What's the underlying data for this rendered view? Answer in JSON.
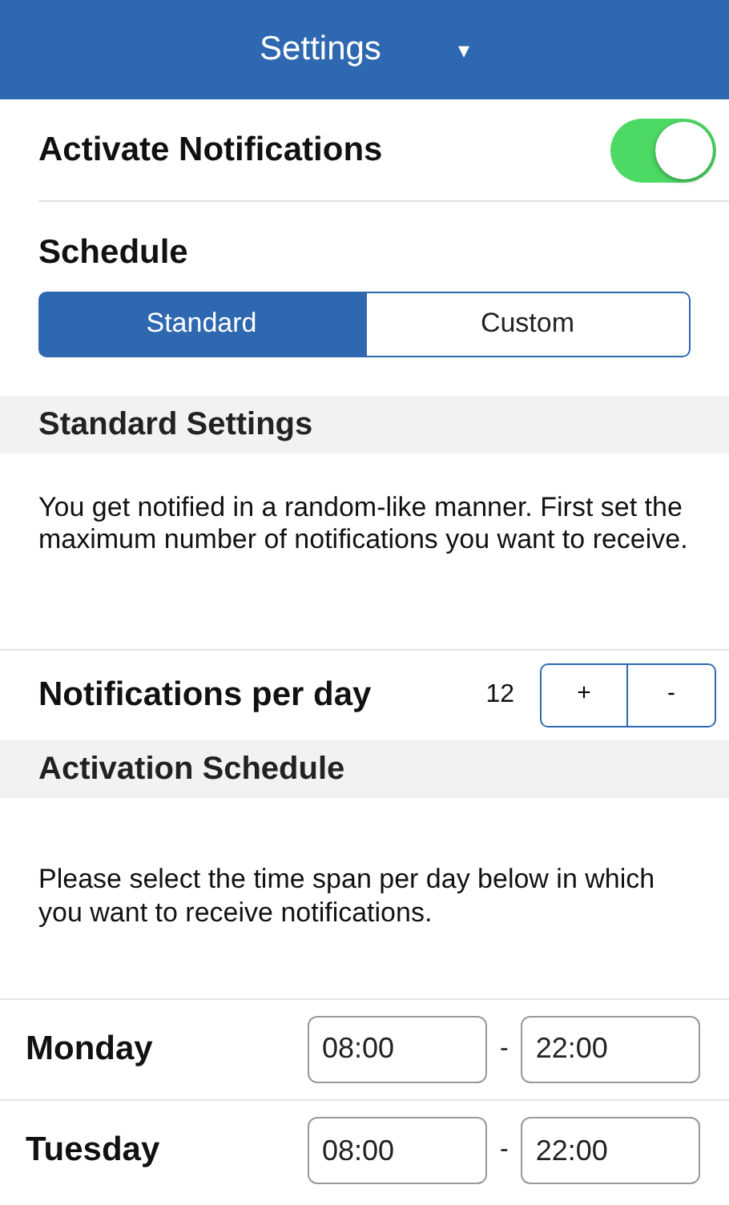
{
  "header": {
    "title": "Settings",
    "dropdown_glyph": "▾"
  },
  "notifications_toggle": {
    "label": "Activate Notifications",
    "on": true
  },
  "schedule": {
    "label": "Schedule",
    "segments": [
      {
        "label": "Standard",
        "selected": true
      },
      {
        "label": "Custom",
        "selected": false
      }
    ]
  },
  "standard_settings": {
    "heading": "Standard Settings",
    "description": "You get notified in a random-like manner. First set the maximum number of notifications you want to receive.",
    "per_day": {
      "label": "Notifications per day",
      "value": "12",
      "buttons": [
        "+",
        "-"
      ]
    }
  },
  "activation_schedule": {
    "heading": "Activation Schedule",
    "description": "Please select the time span per day below in which you want to receive notifications.",
    "days": [
      {
        "day": "Monday",
        "from": "08:00",
        "separator": "-",
        "to": "22:00"
      },
      {
        "day": "Tuesday",
        "from": "08:00",
        "separator": "-",
        "to": "22:00"
      }
    ]
  }
}
